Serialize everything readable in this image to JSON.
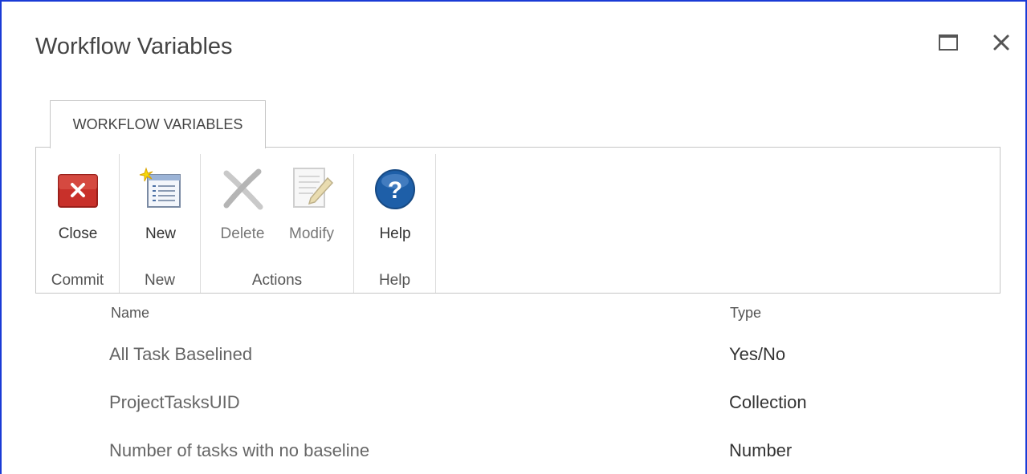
{
  "window": {
    "title": "Workflow Variables",
    "maximize_icon": "maximize-icon",
    "close_icon": "close-icon"
  },
  "ribbon": {
    "tab_label": "WORKFLOW VARIABLES",
    "groups": {
      "commit": {
        "label": "Commit",
        "close_label": "Close"
      },
      "new": {
        "label": "New",
        "new_label": "New"
      },
      "actions": {
        "label": "Actions",
        "delete_label": "Delete",
        "modify_label": "Modify"
      },
      "help": {
        "label": "Help",
        "help_label": "Help"
      }
    },
    "colors": {
      "close_red": "#c8302a",
      "help_blue": "#1e5fa8",
      "accent_border": "#1a3bd6"
    }
  },
  "table": {
    "headers": {
      "name": "Name",
      "type": "Type"
    },
    "rows": [
      {
        "name": "All Task Baselined",
        "type": "Yes/No"
      },
      {
        "name": "ProjectTasksUID",
        "type": "Collection"
      },
      {
        "name": "Number of tasks with no baseline",
        "type": "Number"
      }
    ]
  }
}
